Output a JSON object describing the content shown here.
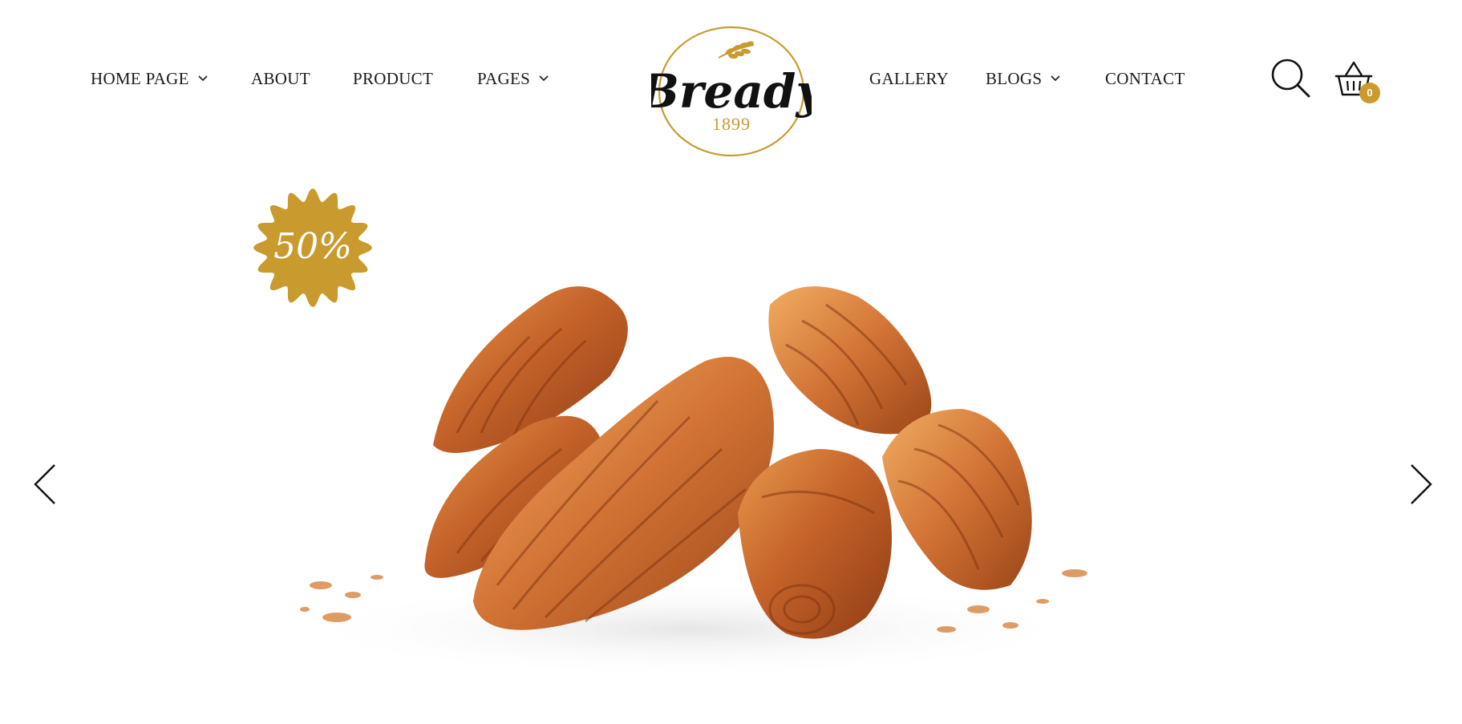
{
  "nav": {
    "left_items": [
      {
        "label": "HOME PAGE",
        "has_dropdown": true
      },
      {
        "label": "ABOUT",
        "has_dropdown": false
      },
      {
        "label": "PRODUCT",
        "has_dropdown": false
      },
      {
        "label": "PAGES",
        "has_dropdown": true
      }
    ],
    "right_items": [
      {
        "label": "GALLERY",
        "has_dropdown": false
      },
      {
        "label": "BLOGS",
        "has_dropdown": true
      },
      {
        "label": "CONTACT",
        "has_dropdown": false
      }
    ]
  },
  "logo": {
    "brand": "Bready",
    "year": "1899",
    "icon": "wheat-icon"
  },
  "header_actions": {
    "search_icon": "search-icon",
    "cart_icon": "basket-icon",
    "cart_count": "0"
  },
  "hero": {
    "badge_text": "50%",
    "prev_icon": "chevron-left-icon",
    "next_icon": "chevron-right-icon",
    "image": "croissants-image"
  },
  "colors": {
    "accent": "#c99a2e",
    "text": "#1a1a1a",
    "background": "#ffffff"
  }
}
